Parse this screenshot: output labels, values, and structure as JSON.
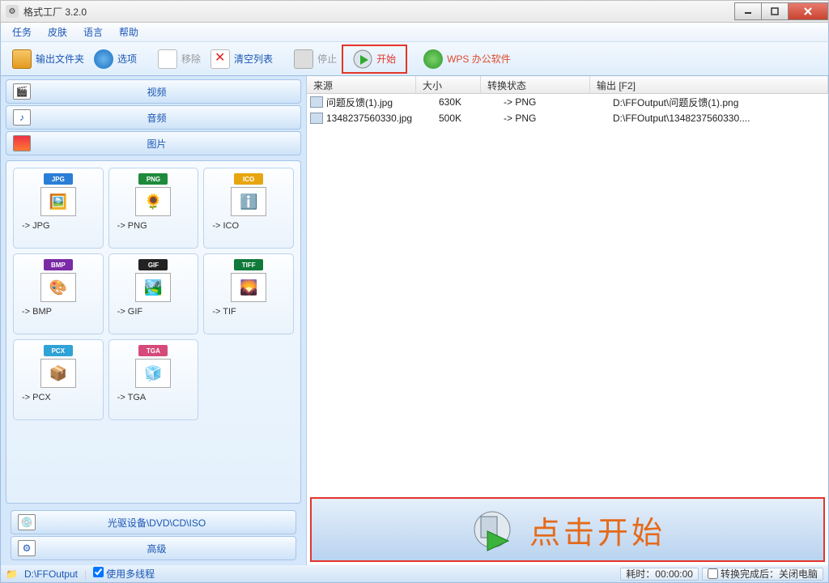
{
  "window": {
    "title": "格式工厂 3.2.0"
  },
  "menu": {
    "task": "任务",
    "skin": "皮肤",
    "lang": "语言",
    "help": "帮助"
  },
  "toolbar": {
    "output_folder": "输出文件夹",
    "options": "选项",
    "remove": "移除",
    "clear": "清空列表",
    "stop": "停止",
    "start": "开始",
    "wps": "WPS 办公软件"
  },
  "categories": {
    "video": "视频",
    "audio": "音频",
    "image": "图片",
    "drive": "光驱设备\\DVD\\CD\\ISO",
    "advanced": "高级"
  },
  "formats": [
    {
      "badge": "JPG",
      "color": "#2b7ed6",
      "emoji": "🖼️",
      "label": "-> JPG"
    },
    {
      "badge": "PNG",
      "color": "#1f8a3b",
      "emoji": "🌻",
      "label": "-> PNG"
    },
    {
      "badge": "ICO",
      "color": "#e7a50f",
      "emoji": "ℹ️",
      "label": "-> ICO"
    },
    {
      "badge": "BMP",
      "color": "#7a2aa5",
      "emoji": "🎨",
      "label": "-> BMP"
    },
    {
      "badge": "GIF",
      "color": "#222",
      "emoji": "🏞️",
      "label": "-> GIF"
    },
    {
      "badge": "TIFF",
      "color": "#107a3a",
      "emoji": "🌄",
      "label": "-> TIF"
    },
    {
      "badge": "PCX",
      "color": "#2fa2d6",
      "emoji": "📦",
      "label": "-> PCX"
    },
    {
      "badge": "TGA",
      "color": "#d64a7a",
      "emoji": "🧊",
      "label": "-> TGA"
    }
  ],
  "listhead": {
    "src": "来源",
    "size": "大小",
    "status": "转换状态",
    "out": "输出 [F2]"
  },
  "rows": [
    {
      "name": "问题反馈(1).jpg",
      "size": "630K",
      "status": "-> PNG",
      "out": "D:\\FFOutput\\问题反馈(1).png"
    },
    {
      "name": "1348237560330.jpg",
      "size": "500K",
      "status": "-> PNG",
      "out": "D:\\FFOutput\\1348237560330...."
    }
  ],
  "cta": {
    "label": "点击开始"
  },
  "status": {
    "folder": "D:\\FFOutput",
    "multi": "使用多线程",
    "elapsed_label": "耗时：",
    "elapsed": "00:00:00",
    "after": "转换完成后：关闭电脑"
  }
}
